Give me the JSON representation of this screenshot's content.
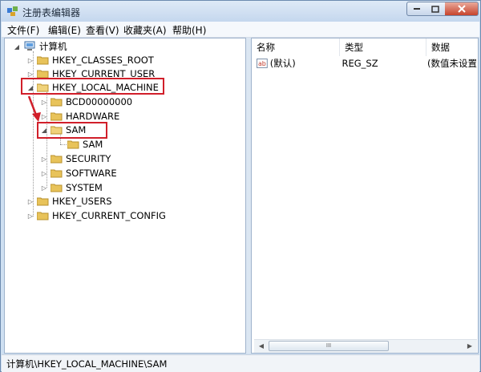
{
  "window": {
    "title": "注册表编辑器"
  },
  "menu": [
    "文件(F)",
    "编辑(E)",
    "查看(V)",
    "收藏夹(A)",
    "帮助(H)"
  ],
  "tree": {
    "root": "计算机",
    "items": [
      "HKEY_CLASSES_ROOT",
      "HKEY_CURRENT_USER",
      "HKEY_LOCAL_MACHINE",
      "BCD00000000",
      "HARDWARE",
      "SAM",
      "SAM",
      "SECURITY",
      "SOFTWARE",
      "SYSTEM",
      "HKEY_USERS",
      "HKEY_CURRENT_CONFIG"
    ]
  },
  "list": {
    "headers": [
      "名称",
      "类型",
      "数据"
    ],
    "rows": [
      {
        "name": "(默认)",
        "type": "REG_SZ",
        "data": "(数值未设置"
      }
    ]
  },
  "scrollbar": {
    "thumb_grip": "III"
  },
  "status": {
    "path": "计算机\\HKEY_LOCAL_MACHINE\\SAM"
  },
  "colors": {
    "highlight_box": "#d11f2a",
    "folder": "#e8c35a"
  }
}
